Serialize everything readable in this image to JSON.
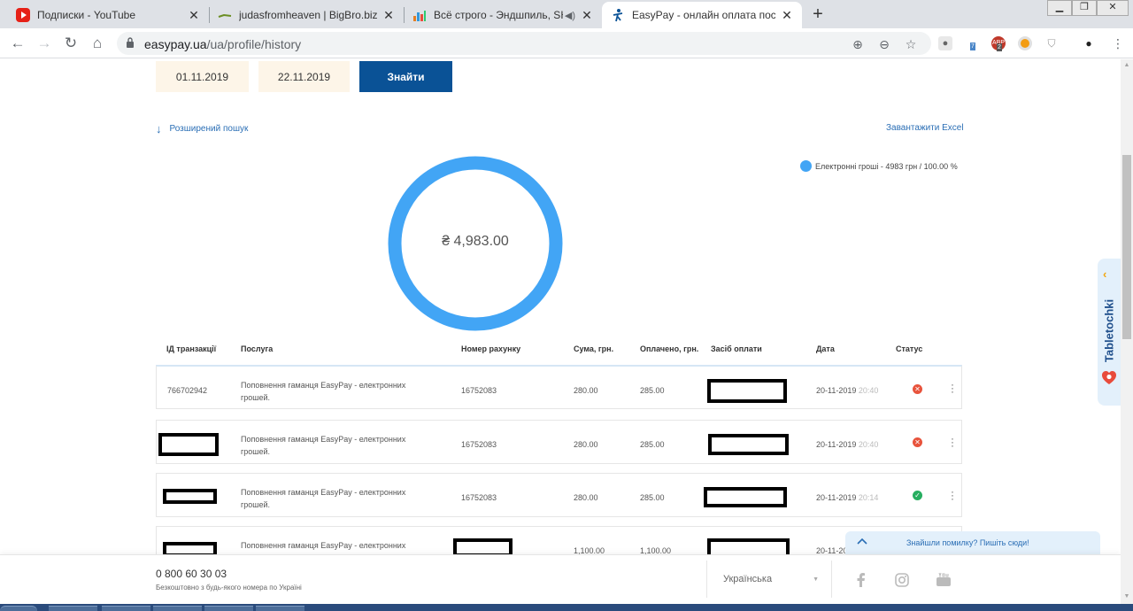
{
  "browser": {
    "tabs": [
      {
        "title": "Подписки - YouTube",
        "icon": "youtube-icon"
      },
      {
        "title": "judasfromheaven | BigBro.biz - о",
        "icon": "bigbro-icon"
      },
      {
        "title": "Всё строго - Эндшпиль, SH",
        "icon": "chart-favicon-icon"
      },
      {
        "title": "EasyPay - онлайн оплата послуг",
        "icon": "easypay-icon"
      }
    ],
    "address": {
      "host": "easypay.ua",
      "path": "/ua/profile/history"
    },
    "ext_badges": {
      "bulb_badge": "7",
      "abp_badge": "2",
      "abp_label": "ABP"
    }
  },
  "filters": {
    "date_from": "01.11.2019",
    "date_to": "22.11.2019",
    "find_label": "Знайти",
    "advanced_search": "Розширений пошук",
    "download_excel": "Завантажити Excel"
  },
  "summary": {
    "total_label": "₴ 4,983.00",
    "legend": "Електронні гроші - 4983 грн / 100.00 %",
    "colors": {
      "ring": "#42a5f5",
      "accent": "#0a5296"
    }
  },
  "table": {
    "headers": {
      "id": "ІД транзакції",
      "service": "Послуга",
      "account": "Номер рахунку",
      "amount": "Сума, грн.",
      "paid": "Оплачено, грн.",
      "method": "Засіб оплати",
      "date": "Дата",
      "status": "Статус"
    },
    "rows": [
      {
        "id": "766702942",
        "service1": "Поповнення гаманця EasyPay - електронних",
        "service2": "грошей.",
        "account": "16752083",
        "amount": "280.00",
        "paid": "285.00",
        "date": "20-11-2019",
        "time": "20:40",
        "status": "failed"
      },
      {
        "id": "",
        "service1": "Поповнення гаманця EasyPay - електронних",
        "service2": "грошей.",
        "account": "16752083",
        "amount": "280.00",
        "paid": "285.00",
        "date": "20-11-2019",
        "time": "20:40",
        "status": "failed"
      },
      {
        "id": "",
        "service1": "Поповнення гаманця EasyPay - електронних",
        "service2": "грошей.",
        "account": "16752083",
        "amount": "280.00",
        "paid": "285.00",
        "date": "20-11-2019",
        "time": "20:14",
        "status": "success"
      },
      {
        "id": "",
        "service1": "Поповнення гаманця EasyPay - електронних",
        "service2": "",
        "account": "",
        "amount": "1,100.00",
        "paid": "1,100.00",
        "date": "20-11-20",
        "time": "",
        "status": ""
      }
    ]
  },
  "footer": {
    "phone": "0 800 60 30 03",
    "phone_note": "Безкоштовно з будь-якого номера по Україні",
    "language": "Українська"
  },
  "report_widget": {
    "text": "Знайшли помилку? Пишіть сюди!"
  },
  "side_widget": {
    "brand": "Tabletochki"
  }
}
